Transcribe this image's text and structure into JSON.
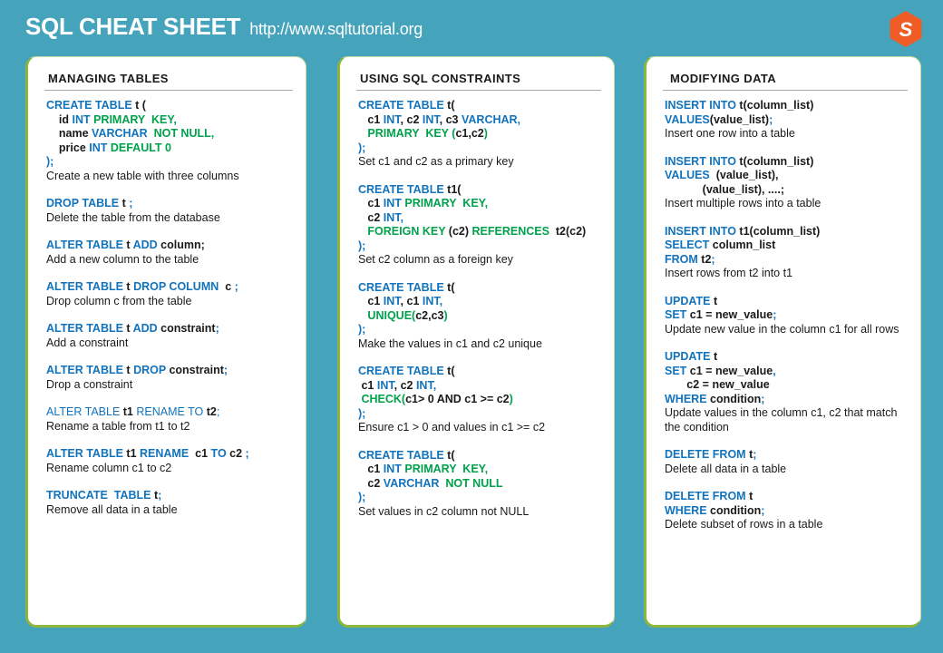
{
  "header": {
    "title": "SQL CHEAT SHEET",
    "url": "http://www.sqltutorial.org",
    "logo_letter": "S",
    "logo_name": "sqltutorial-hexagon-logo"
  },
  "colors": {
    "background": "#45a3bc",
    "card_background": "#ffffff",
    "card_border": "#8cb63c",
    "keyword_blue": "#1273bd",
    "constraint_green": "#00a14b",
    "identifier_black": "#1a1a1a",
    "logo_orange": "#ef5c26",
    "header_text": "#ffffff"
  },
  "columns": [
    {
      "title": "MANAGING  TABLES",
      "entries": [
        {
          "code": [
            [
              {
                "t": "CREATE TABLE ",
                "c": "kw"
              },
              {
                "t": "t",
                "c": "id"
              },
              {
                "t": " (",
                "c": "id"
              }
            ],
            [
              {
                "t": "    id ",
                "c": "id"
              },
              {
                "t": "INT ",
                "c": "kw"
              },
              {
                "t": "PRIMARY  KEY",
                "c": "gr"
              },
              {
                "t": ",",
                "c": "gr"
              }
            ],
            [
              {
                "t": "    name ",
                "c": "id"
              },
              {
                "t": "VARCHAR  ",
                "c": "kw"
              },
              {
                "t": "NOT NULL",
                "c": "gr"
              },
              {
                "t": ",",
                "c": "gr"
              }
            ],
            [
              {
                "t": "    price ",
                "c": "id"
              },
              {
                "t": "INT ",
                "c": "kw"
              },
              {
                "t": "DEFAULT 0",
                "c": "gr"
              }
            ],
            [
              {
                "t": ");",
                "c": "kw"
              }
            ]
          ],
          "desc": "Create a new table with three columns"
        },
        {
          "code": [
            [
              {
                "t": "DROP TABLE ",
                "c": "kw"
              },
              {
                "t": "t ",
                "c": "id"
              },
              {
                "t": ";",
                "c": "kw"
              }
            ]
          ],
          "desc": "Delete the table from the database"
        },
        {
          "code": [
            [
              {
                "t": "ALTER TABLE ",
                "c": "kw"
              },
              {
                "t": "t ",
                "c": "id"
              },
              {
                "t": "ADD ",
                "c": "kw"
              },
              {
                "t": "column;",
                "c": "id"
              }
            ]
          ],
          "desc": "Add a new column to the table"
        },
        {
          "code": [
            [
              {
                "t": "ALTER TABLE ",
                "c": "kw"
              },
              {
                "t": "t ",
                "c": "id"
              },
              {
                "t": "DROP COLUMN ",
                "c": "kw"
              },
              {
                "t": " c ",
                "c": "id"
              },
              {
                "t": ";",
                "c": "kw"
              }
            ]
          ],
          "desc": "Drop column c from the table"
        },
        {
          "code": [
            [
              {
                "t": "ALTER TABLE ",
                "c": "kw"
              },
              {
                "t": "t ",
                "c": "id"
              },
              {
                "t": "ADD ",
                "c": "kw"
              },
              {
                "t": "constraint",
                "c": "id"
              },
              {
                "t": ";",
                "c": "kw"
              }
            ]
          ],
          "desc": "Add a constraint"
        },
        {
          "code": [
            [
              {
                "t": "ALTER TABLE ",
                "c": "kw"
              },
              {
                "t": "t ",
                "c": "id"
              },
              {
                "t": "DROP ",
                "c": "kw"
              },
              {
                "t": "constraint",
                "c": "id"
              },
              {
                "t": ";",
                "c": "kw"
              }
            ]
          ],
          "desc": "Drop a constraint"
        },
        {
          "code": [
            [
              {
                "t": "ALTER TABLE ",
                "c": "lt"
              },
              {
                "t": "t1 ",
                "c": "id"
              },
              {
                "t": "RENAME TO ",
                "c": "lt"
              },
              {
                "t": "t2",
                "c": "id"
              },
              {
                "t": ";",
                "c": "lt"
              }
            ]
          ],
          "desc": "Rename a table from t1 to t2"
        },
        {
          "code": [
            [
              {
                "t": "ALTER TABLE ",
                "c": "kw"
              },
              {
                "t": "t1 ",
                "c": "id"
              },
              {
                "t": "RENAME ",
                "c": "kw"
              },
              {
                "t": " c1 ",
                "c": "id"
              },
              {
                "t": "TO ",
                "c": "kw"
              },
              {
                "t": "c2 ",
                "c": "id"
              },
              {
                "t": ";",
                "c": "kw"
              }
            ]
          ],
          "desc": "Rename column c1 to c2"
        },
        {
          "code": [
            [
              {
                "t": "TRUNCATE  TABLE ",
                "c": "kw"
              },
              {
                "t": "t",
                "c": "id"
              },
              {
                "t": ";",
                "c": "kw"
              }
            ]
          ],
          "desc": "Remove all data in a table"
        }
      ]
    },
    {
      "title": "USING  SQL CONSTRAINTS",
      "entries": [
        {
          "code": [
            [
              {
                "t": "CREATE TABLE ",
                "c": "kw"
              },
              {
                "t": "t(",
                "c": "id"
              }
            ],
            [
              {
                "t": "   c1 ",
                "c": "id"
              },
              {
                "t": "INT",
                "c": "kw"
              },
              {
                "t": ", ",
                "c": "id"
              },
              {
                "t": "c2 ",
                "c": "id"
              },
              {
                "t": "INT",
                "c": "kw"
              },
              {
                "t": ", ",
                "c": "id"
              },
              {
                "t": "c3 ",
                "c": "id"
              },
              {
                "t": "VARCHAR,",
                "c": "kw"
              }
            ],
            [
              {
                "t": "   PRIMARY  KEY ",
                "c": "gr"
              },
              {
                "t": "(",
                "c": "gr"
              },
              {
                "t": "c1,c2",
                "c": "id"
              },
              {
                "t": ")",
                "c": "gr"
              }
            ],
            [
              {
                "t": ");",
                "c": "kw"
              }
            ]
          ],
          "desc": "Set c1 and c2 as a primary key"
        },
        {
          "code": [
            [
              {
                "t": "CREATE TABLE ",
                "c": "kw"
              },
              {
                "t": "t1(",
                "c": "id"
              }
            ],
            [
              {
                "t": "   c1 ",
                "c": "id"
              },
              {
                "t": "INT ",
                "c": "kw"
              },
              {
                "t": "PRIMARY  KEY,",
                "c": "gr"
              }
            ],
            [
              {
                "t": "   c2 ",
                "c": "id"
              },
              {
                "t": "INT,",
                "c": "kw"
              }
            ],
            [
              {
                "t": "   FOREIGN KEY ",
                "c": "gr"
              },
              {
                "t": "(c2) ",
                "c": "id"
              },
              {
                "t": "REFERENCES ",
                "c": "gr"
              },
              {
                "t": " t2(c2)",
                "c": "id"
              }
            ],
            [
              {
                "t": ");",
                "c": "kw"
              }
            ]
          ],
          "desc": "Set c2 column as a foreign key"
        },
        {
          "code": [
            [
              {
                "t": "CREATE TABLE ",
                "c": "kw"
              },
              {
                "t": "t(",
                "c": "id"
              }
            ],
            [
              {
                "t": "   c1 ",
                "c": "id"
              },
              {
                "t": "INT",
                "c": "kw"
              },
              {
                "t": ", ",
                "c": "id"
              },
              {
                "t": "c1 ",
                "c": "id"
              },
              {
                "t": "INT,",
                "c": "kw"
              }
            ],
            [
              {
                "t": "   UNIQUE",
                "c": "gr"
              },
              {
                "t": "(",
                "c": "gr"
              },
              {
                "t": "c2,c3",
                "c": "id"
              },
              {
                "t": ")",
                "c": "gr"
              }
            ],
            [
              {
                "t": ");",
                "c": "kw"
              }
            ]
          ],
          "desc": "Make the values in c1 and c2 unique"
        },
        {
          "code": [
            [
              {
                "t": "CREATE TABLE ",
                "c": "kw"
              },
              {
                "t": "t(",
                "c": "id"
              }
            ],
            [
              {
                "t": " c1 ",
                "c": "id"
              },
              {
                "t": "INT",
                "c": "kw"
              },
              {
                "t": ", ",
                "c": "id"
              },
              {
                "t": "c2 ",
                "c": "id"
              },
              {
                "t": "INT,",
                "c": "kw"
              }
            ],
            [
              {
                "t": " CHECK",
                "c": "gr"
              },
              {
                "t": "(",
                "c": "gr"
              },
              {
                "t": "c1> 0 AND c1 >= c2",
                "c": "id"
              },
              {
                "t": ")",
                "c": "gr"
              }
            ],
            [
              {
                "t": ");",
                "c": "kw"
              }
            ]
          ],
          "desc": "Ensure c1 > 0 and values in c1 >= c2"
        },
        {
          "code": [
            [
              {
                "t": "CREATE TABLE ",
                "c": "kw"
              },
              {
                "t": "t(",
                "c": "id"
              }
            ],
            [
              {
                "t": "   c1 ",
                "c": "id"
              },
              {
                "t": "INT ",
                "c": "kw"
              },
              {
                "t": "PRIMARY  KEY,",
                "c": "gr"
              }
            ],
            [
              {
                "t": "   c2 ",
                "c": "id"
              },
              {
                "t": "VARCHAR  ",
                "c": "kw"
              },
              {
                "t": "NOT NULL",
                "c": "gr"
              }
            ],
            [
              {
                "t": ");",
                "c": "kw"
              }
            ]
          ],
          "desc": "Set values in c2 column not NULL"
        }
      ]
    },
    {
      "title": "MODIFYING DATA",
      "entries": [
        {
          "code": [
            [
              {
                "t": "INSERT INTO ",
                "c": "kw"
              },
              {
                "t": "t(column_list)",
                "c": "id"
              }
            ],
            [
              {
                "t": "VALUES",
                "c": "kw"
              },
              {
                "t": "(value_list)",
                "c": "id"
              },
              {
                "t": ";",
                "c": "kw"
              }
            ]
          ],
          "desc": "Insert one row into a table"
        },
        {
          "code": [
            [
              {
                "t": "INSERT INTO ",
                "c": "kw"
              },
              {
                "t": "t(column_list)",
                "c": "id"
              }
            ],
            [
              {
                "t": "VALUES ",
                "c": "kw"
              },
              {
                "t": " (value_list),",
                "c": "id"
              }
            ],
            [
              {
                "t": "            (value_list), ....;",
                "c": "id"
              }
            ]
          ],
          "desc": "Insert multiple rows into a table"
        },
        {
          "code": [
            [
              {
                "t": "INSERT INTO ",
                "c": "kw"
              },
              {
                "t": "t1(column_list)",
                "c": "id"
              }
            ],
            [
              {
                "t": "SELECT ",
                "c": "kw"
              },
              {
                "t": "column_list",
                "c": "id"
              }
            ],
            [
              {
                "t": "FROM ",
                "c": "kw"
              },
              {
                "t": "t2",
                "c": "id"
              },
              {
                "t": ";",
                "c": "kw"
              }
            ]
          ],
          "desc": "Insert rows from t2 into t1"
        },
        {
          "code": [
            [
              {
                "t": "UPDATE ",
                "c": "kw"
              },
              {
                "t": "t",
                "c": "id"
              }
            ],
            [
              {
                "t": "SET ",
                "c": "kw"
              },
              {
                "t": "c1 = new_value",
                "c": "id"
              },
              {
                "t": ";",
                "c": "kw"
              }
            ]
          ],
          "desc": "Update new value in the column c1 for all rows"
        },
        {
          "code": [
            [
              {
                "t": "UPDATE ",
                "c": "kw"
              },
              {
                "t": "t",
                "c": "id"
              }
            ],
            [
              {
                "t": "SET ",
                "c": "kw"
              },
              {
                "t": "c1 = new_value",
                "c": "id"
              },
              {
                "t": ",",
                "c": "kw"
              }
            ],
            [
              {
                "t": "       c2 = new_value",
                "c": "id"
              }
            ],
            [
              {
                "t": "WHERE ",
                "c": "kw"
              },
              {
                "t": "condition",
                "c": "id"
              },
              {
                "t": ";",
                "c": "kw"
              }
            ]
          ],
          "desc": "Update values in the column c1, c2 that match\nthe condition"
        },
        {
          "code": [
            [
              {
                "t": "DELETE FROM ",
                "c": "kw"
              },
              {
                "t": "t",
                "c": "id"
              },
              {
                "t": ";",
                "c": "kw"
              }
            ]
          ],
          "desc": "Delete all data in a table"
        },
        {
          "code": [
            [
              {
                "t": "DELETE FROM ",
                "c": "kw"
              },
              {
                "t": "t",
                "c": "id"
              }
            ],
            [
              {
                "t": "WHERE ",
                "c": "kw"
              },
              {
                "t": "condition",
                "c": "id"
              },
              {
                "t": ";",
                "c": "kw"
              }
            ]
          ],
          "desc": "Delete subset of rows in a table"
        }
      ]
    }
  ]
}
